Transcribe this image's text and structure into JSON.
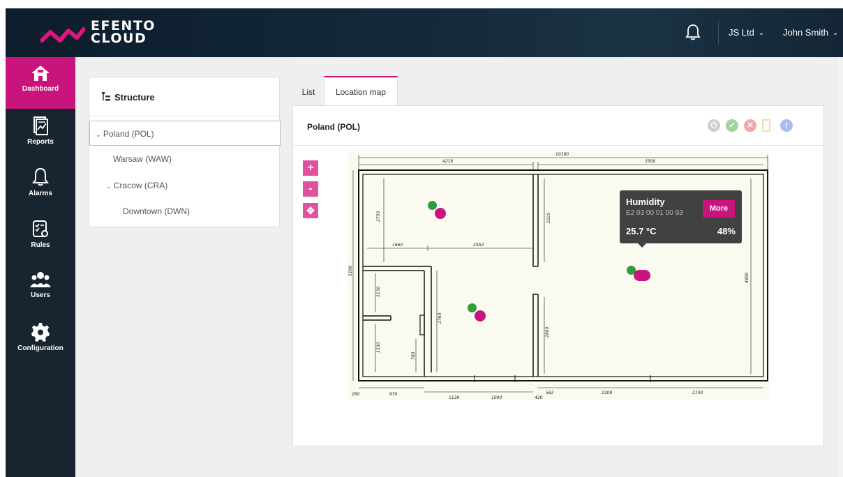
{
  "app": {
    "logo_line1": "EFENTO",
    "logo_line2": "CLOUD",
    "brand_color": "#c8147c"
  },
  "header": {
    "organization": "JS Ltd",
    "user": "John Smith",
    "bell_icon": "bell-icon"
  },
  "sidebar": {
    "items": [
      {
        "label": "Dashboard",
        "icon": "home-icon",
        "active": true
      },
      {
        "label": "Reports",
        "icon": "report-icon"
      },
      {
        "label": "Alarms",
        "icon": "bell-icon"
      },
      {
        "label": "Rules",
        "icon": "rules-icon"
      },
      {
        "label": "Users",
        "icon": "users-icon"
      },
      {
        "label": "Configuration",
        "icon": "gear-icon"
      }
    ]
  },
  "structure": {
    "title": "Structure",
    "tree": [
      {
        "label": "Poland (POL)",
        "selected": true
      },
      {
        "label": "Warsaw (WAW)"
      },
      {
        "label": "Cracow (CRA)"
      },
      {
        "label": "Downtown (DWN)"
      }
    ]
  },
  "tabs": [
    {
      "label": "List"
    },
    {
      "label": "Location map",
      "active": true
    }
  ],
  "map": {
    "title": "Poland (POL)",
    "zoom_in": "+",
    "zoom_out": "-",
    "status_colors": {
      "power": "#cfcfcf",
      "ok": "#9fd49a",
      "error": "#f2a7ad",
      "battery": "#f3d9a6",
      "info": "#a9bdf0"
    },
    "dimensions": {
      "top_total": "10160",
      "top_left": "4210",
      "top_right": "5500",
      "d2750": "2750",
      "d2225": "2225",
      "d1660": "1660",
      "d2550": "2550",
      "d5190": "5190",
      "d1130a": "1130",
      "d2760": "2760",
      "d2800": "2800",
      "d4890": "4890",
      "d1330": "1330",
      "d780": "780",
      "d280": "280",
      "d970": "970",
      "d1130": "1130",
      "d1000": "1000",
      "d420": "420",
      "d562": "562",
      "d2209": "2209",
      "d2730": "2730"
    }
  },
  "tooltip": {
    "title": "Humidity",
    "serial": "E2 03 00 01 00 93",
    "more": "More",
    "temperature": "25.7 °C",
    "humidity": "48%"
  }
}
